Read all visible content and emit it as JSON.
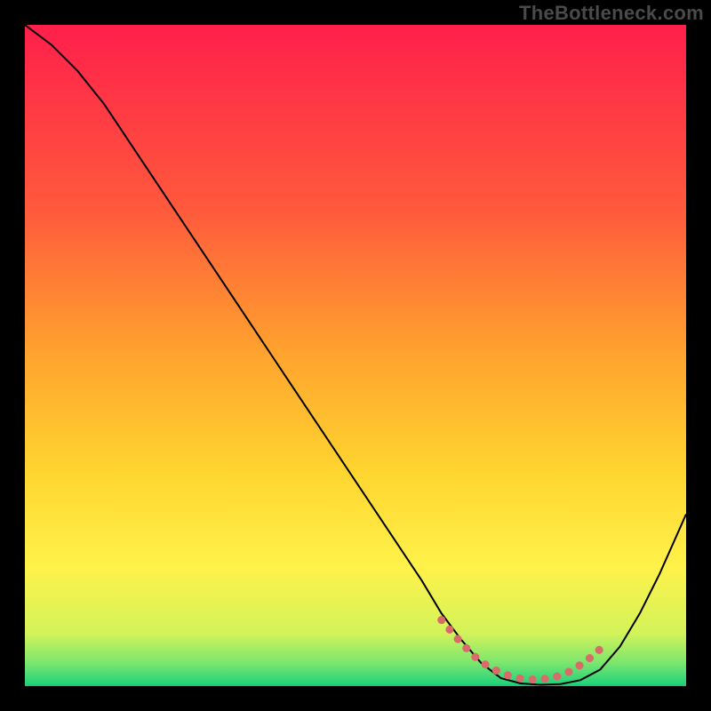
{
  "watermark": "TheBottleneck.com",
  "chart_data": {
    "type": "line",
    "title": "",
    "xlabel": "",
    "ylabel": "",
    "xlim": [
      0,
      100
    ],
    "ylim": [
      0,
      100
    ],
    "background_gradient_stops": [
      {
        "offset": 0,
        "color": "#ff1f4b"
      },
      {
        "offset": 0.28,
        "color": "#ff5a3c"
      },
      {
        "offset": 0.5,
        "color": "#ffa42e"
      },
      {
        "offset": 0.68,
        "color": "#ffd630"
      },
      {
        "offset": 0.82,
        "color": "#fff24a"
      },
      {
        "offset": 0.92,
        "color": "#d3f35a"
      },
      {
        "offset": 0.965,
        "color": "#7be66e"
      },
      {
        "offset": 0.995,
        "color": "#28d47a"
      },
      {
        "offset": 1.0,
        "color": "#12c972"
      }
    ],
    "series": [
      {
        "name": "bottleneck-curve",
        "color": "#000000",
        "width": 2,
        "x": [
          0,
          4,
          8,
          12,
          16,
          20,
          24,
          28,
          32,
          36,
          40,
          44,
          48,
          52,
          56,
          60,
          63,
          66,
          69,
          72,
          75,
          78,
          81,
          84,
          87,
          90,
          93,
          96,
          100
        ],
        "y": [
          100,
          97,
          93,
          88,
          82,
          76,
          70,
          64,
          58,
          52,
          46,
          40,
          34,
          28,
          22,
          16,
          11,
          7,
          3.5,
          1.2,
          0.4,
          0.2,
          0.3,
          0.9,
          2.5,
          6,
          11,
          17,
          26
        ]
      },
      {
        "name": "optimal-range-marker",
        "color": "#d96b6b",
        "width": 9,
        "linecap": "round",
        "dash": "0.1 14",
        "x": [
          63,
          66,
          68,
          70,
          72,
          74,
          76,
          78,
          80,
          82,
          84,
          85.5,
          87
        ],
        "y": [
          10,
          6.5,
          4.5,
          3.0,
          2.0,
          1.3,
          1.0,
          1.0,
          1.3,
          2.0,
          3.2,
          4.3,
          5.6
        ]
      }
    ]
  }
}
